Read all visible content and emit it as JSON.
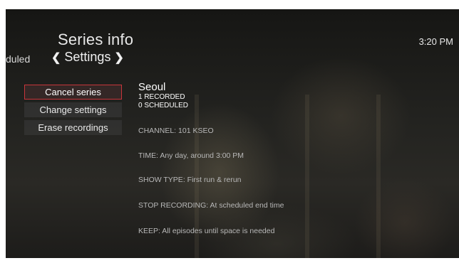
{
  "header": {
    "title": "Series info",
    "clock": "3:20 PM",
    "prev_tab": "duled",
    "current_tab": "Settings",
    "left_chevron": "❮",
    "right_chevron": "❯"
  },
  "menu": {
    "items": [
      {
        "label": "Cancel series",
        "selected": true
      },
      {
        "label": "Change settings",
        "selected": false
      },
      {
        "label": "Erase recordings",
        "selected": false
      }
    ]
  },
  "series": {
    "name": "Seoul",
    "recorded": "1 RECORDED",
    "scheduled": "0 SCHEDULED",
    "details": [
      "CHANNEL: 101 KSEO",
      "TIME: Any day, around 3:00 PM",
      "SHOW TYPE: First run & rerun",
      "STOP RECORDING: At scheduled end time",
      "KEEP: All episodes until space is needed"
    ]
  },
  "colors": {
    "selection_border": "#c8353b",
    "text": "#e8e8e8"
  }
}
